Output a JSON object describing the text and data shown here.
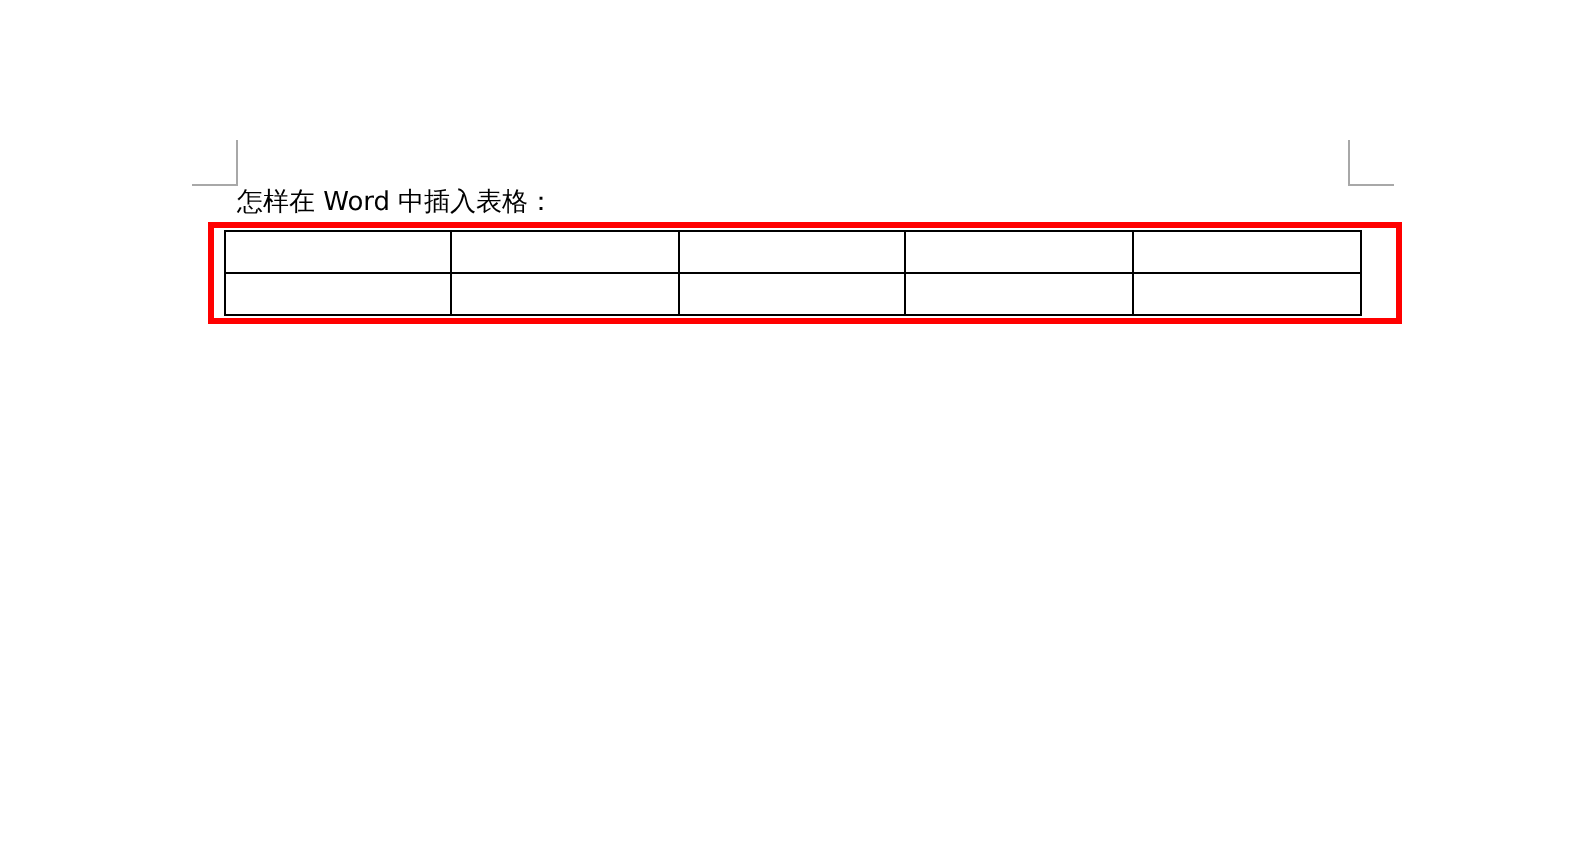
{
  "document": {
    "heading": "怎样在 Word 中插入表格：",
    "table": {
      "highlighted": true
    }
  }
}
